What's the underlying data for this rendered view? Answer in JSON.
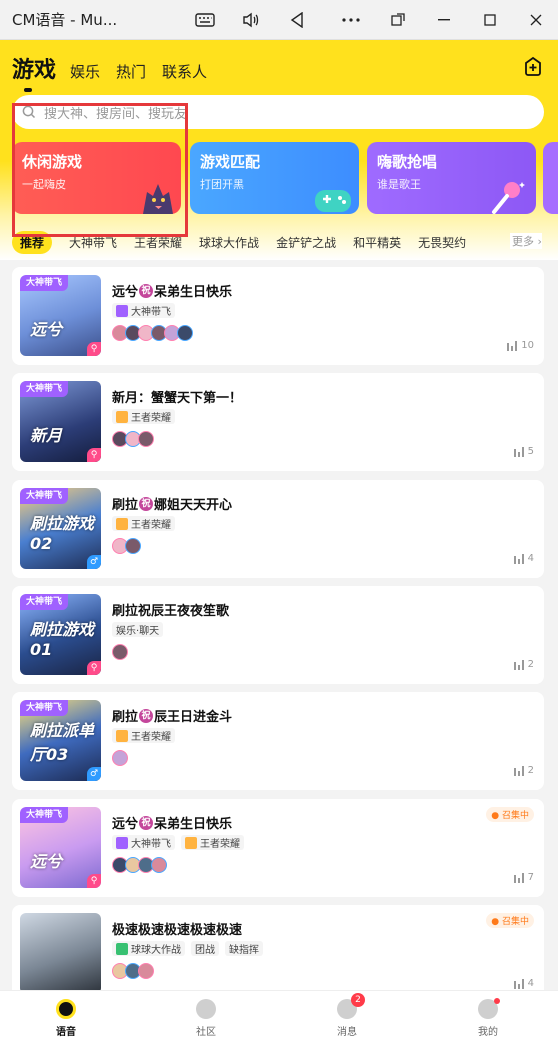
{
  "window": {
    "title": "CM语音 - Mu..."
  },
  "header": {
    "main_tab": "游戏",
    "tabs": [
      "娱乐",
      "热门",
      "联系人"
    ]
  },
  "search": {
    "placeholder": "搜大神、搜房间、搜玩友"
  },
  "categories": [
    {
      "title": "休闲游戏",
      "subtitle": "一起嗨皮"
    },
    {
      "title": "游戏匹配",
      "subtitle": "打团开黑"
    },
    {
      "title": "嗨歌抢唱",
      "subtitle": "谁是歌王"
    }
  ],
  "subtabs": [
    "推荐",
    "大神带飞",
    "王者荣耀",
    "球球大作战",
    "金铲铲之战",
    "和平精英",
    "无畏契约"
  ],
  "more_label": "更多",
  "rooms": [
    {
      "badge": "大神带飞",
      "caption": "远兮",
      "title_a": "远兮",
      "title_b": "呆弟生日快乐",
      "zhu": "祝",
      "tags": [
        "大神带飞"
      ],
      "count": "10",
      "recruit": ""
    },
    {
      "badge": "大神带飞",
      "caption": "新月",
      "title_a": "新月：蟹蟹天下第一！",
      "title_b": "",
      "zhu": "",
      "tags": [
        "王者荣耀"
      ],
      "count": "5",
      "recruit": ""
    },
    {
      "badge": "大神带飞",
      "caption": "刷拉游戏02",
      "title_a": "刷拉",
      "title_b": "娜姐天天开心",
      "zhu": "祝",
      "tags": [
        "王者荣耀"
      ],
      "count": "4",
      "recruit": ""
    },
    {
      "badge": "大神带飞",
      "caption": "刷拉游戏01",
      "title_a": "刷拉祝辰王夜夜笙歌",
      "title_b": "",
      "zhu": "",
      "tags": [
        "娱乐·聊天"
      ],
      "count": "2",
      "recruit": ""
    },
    {
      "badge": "大神带飞",
      "caption": "刷拉派单厅03",
      "title_a": "刷拉",
      "title_b": "辰王日进金斗",
      "zhu": "祝",
      "tags": [
        "王者荣耀"
      ],
      "count": "2",
      "recruit": ""
    },
    {
      "badge": "大神带飞",
      "caption": "远兮",
      "title_a": "远兮",
      "title_b": "呆弟生日快乐",
      "zhu": "祝",
      "tags": [
        "大神带飞",
        "王者荣耀"
      ],
      "count": "7",
      "recruit": "召集中"
    },
    {
      "badge": "",
      "caption": "",
      "title_a": "极速极速极速极速极速",
      "title_b": "",
      "zhu": "",
      "tags": [
        "球球大作战",
        "团战",
        "缺指挥"
      ],
      "count": "4",
      "recruit": "召集中"
    }
  ],
  "nav": {
    "items": [
      "语音",
      "社区",
      "消息",
      "我的"
    ],
    "message_badge": "2"
  },
  "colors": {
    "brand_yellow": "#ffe11d",
    "badge_purple": "#a061ff",
    "alert_red": "#ff3b49"
  }
}
